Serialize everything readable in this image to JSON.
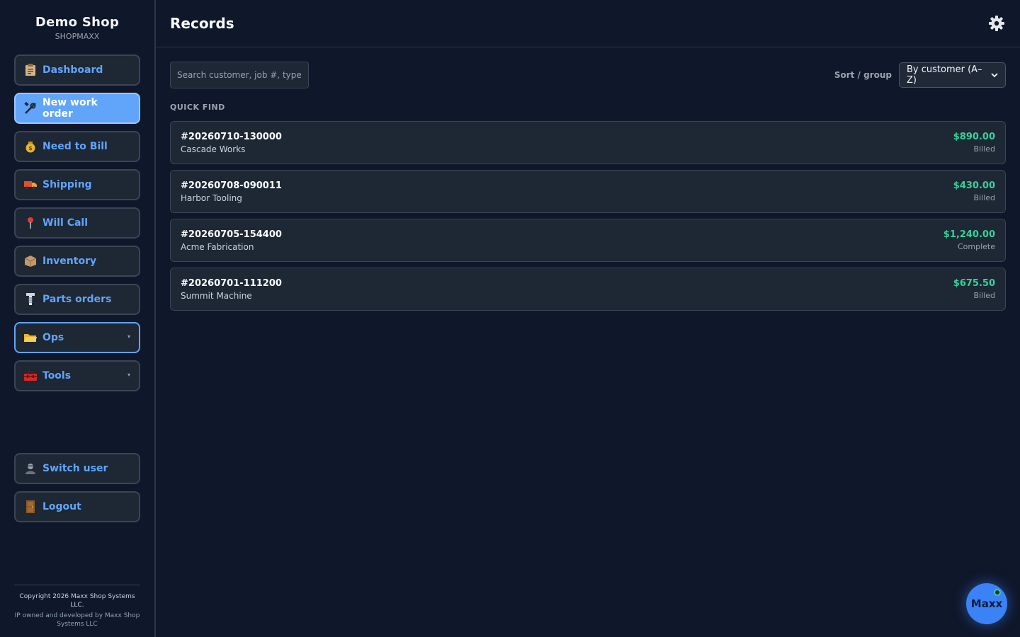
{
  "brand": {
    "title": "Demo Shop",
    "subtitle": "SHOPMAXX"
  },
  "sidebar": {
    "items": [
      {
        "label": "Dashboard",
        "icon": "clipboard-icon"
      },
      {
        "label": "New work order",
        "icon": "tools-icon",
        "active": true
      },
      {
        "label": "Need to Bill",
        "icon": "money-bag-icon"
      },
      {
        "label": "Shipping",
        "icon": "truck-icon"
      },
      {
        "label": "Will Call",
        "icon": "pushpin-icon"
      },
      {
        "label": "Inventory",
        "icon": "box-icon"
      },
      {
        "label": "Parts orders",
        "icon": "screw-icon"
      },
      {
        "label": "Ops",
        "icon": "folder-icon",
        "expandable": true
      },
      {
        "label": "Tools",
        "icon": "toolbox-icon",
        "expandable": true
      }
    ],
    "bottom": [
      {
        "label": "Switch user",
        "icon": "user-icon"
      },
      {
        "label": "Logout",
        "icon": "door-icon"
      }
    ]
  },
  "footer": {
    "copyright": "Copyright 2026 Maxx Shop Systems LLC.",
    "ip": "IP owned and developed by Maxx Shop Systems LLC"
  },
  "header": {
    "title": "Records"
  },
  "toolbar": {
    "search_placeholder": "Search customer, job #, type, p...",
    "sort_label": "Sort / group",
    "sort_value": "By customer (A–Z)"
  },
  "quick_find": {
    "label": "QUICK FIND",
    "rows": [
      {
        "job": "#20260710-130000",
        "customer": "Cascade Works",
        "amount": "$890.00",
        "status": "Billed"
      },
      {
        "job": "#20260708-090011",
        "customer": "Harbor Tooling",
        "amount": "$430.00",
        "status": "Billed"
      },
      {
        "job": "#20260705-154400",
        "customer": "Acme Fabrication",
        "amount": "$1,240.00",
        "status": "Complete"
      },
      {
        "job": "#20260701-111200",
        "customer": "Summit Machine",
        "amount": "$675.50",
        "status": "Billed"
      }
    ]
  },
  "assistant": {
    "label": "Maxx"
  },
  "colors": {
    "accent": "#60a5fa",
    "amount": "#34d399",
    "background": "#0f172a"
  }
}
